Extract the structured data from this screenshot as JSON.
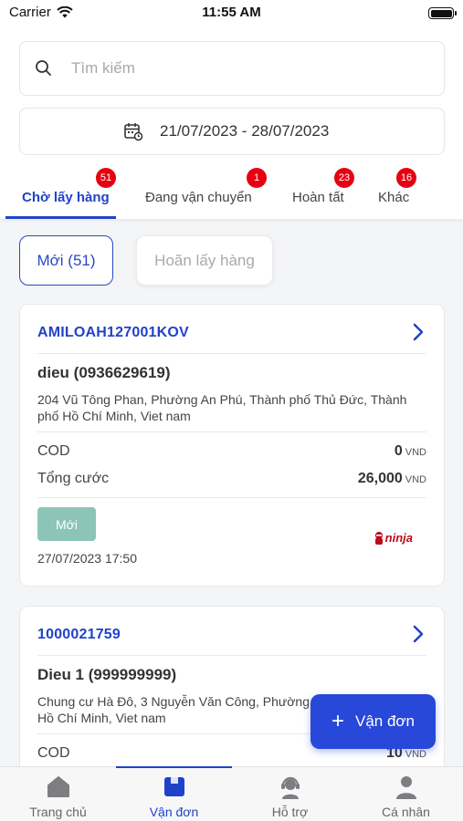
{
  "status_bar": {
    "carrier": "Carrier",
    "time": "11:55 AM"
  },
  "search": {
    "placeholder": "Tìm kiếm"
  },
  "date_range": {
    "label": "21/07/2023 - 28/07/2023"
  },
  "tabs": [
    {
      "label": "Chờ lấy hàng",
      "badge": "51",
      "active": true
    },
    {
      "label": "Đang vận chuyển",
      "badge": "1",
      "active": false
    },
    {
      "label": "Hoàn tất",
      "badge": "23",
      "active": false
    },
    {
      "label": "Khác",
      "badge": "16",
      "active": false
    }
  ],
  "filters": [
    {
      "label": "Mới (51)",
      "selected": true
    },
    {
      "label": "Hoãn lấy hàng",
      "selected": false
    }
  ],
  "orders": [
    {
      "code": "AMILOAH127001KOV",
      "customer": "dieu (0936629619)",
      "address": "204 Vũ Tông Phan, Phường An Phú, Thành phố Thủ Đức, Thành phố Hồ Chí Minh, Viet nam",
      "cod_label": "COD",
      "cod_value": "0",
      "fee_label": "Tổng cước",
      "fee_value": "26,000",
      "currency": "VND",
      "status": "Mới",
      "datetime": "27/07/2023 17:50",
      "carrier_logo": "ninja"
    },
    {
      "code": "1000021759",
      "customer": "Dieu 1 (999999999)",
      "address": "Chung cư Hà Đô, 3 Nguyễn Văn Công, Phường Vấp, Thành phố Hồ Chí Minh, Viet nam",
      "cod_label": "COD",
      "cod_value": "10",
      "currency": "VND"
    }
  ],
  "fab": {
    "label": "Vận đơn"
  },
  "bottom_nav": [
    {
      "label": "Trang chủ",
      "icon": "home-icon",
      "active": false
    },
    {
      "label": "Vận đơn",
      "icon": "package-icon",
      "active": true
    },
    {
      "label": "Hỗ trợ",
      "icon": "support-agent-icon",
      "active": false
    },
    {
      "label": "Cá nhân",
      "icon": "person-icon",
      "active": false
    }
  ],
  "colors": {
    "primary": "#2042c9",
    "badge": "#e60012",
    "status_new": "#8cc5b8"
  }
}
